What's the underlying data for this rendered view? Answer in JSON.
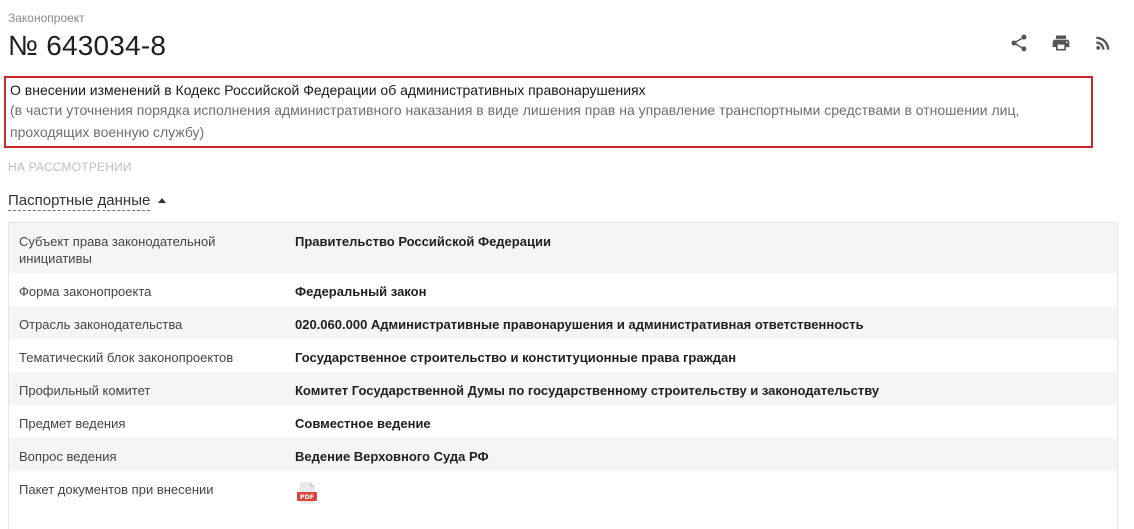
{
  "header": {
    "kicker": "Законопроект",
    "number": "№ 643034-8"
  },
  "actions": {
    "share_icon": "share-icon",
    "print_icon": "print-icon",
    "rss_icon": "rss-icon"
  },
  "title": {
    "main": "О внесении изменений в Кодекс Российской Федерации об административных правонарушениях",
    "sub": "(в части уточнения порядка исполнения административного наказания в виде лишения прав на управление транспортными средствами в отношении лиц, проходящих военную службу)"
  },
  "status": "НА РАССМОТРЕНИИ",
  "passport": {
    "toggle_label": "Паспортные данные",
    "rows": [
      {
        "label": "Субъект права законодательной инициативы",
        "value": "Правительство Российской Федерации"
      },
      {
        "label": "Форма законопроекта",
        "value": "Федеральный закон"
      },
      {
        "label": "Отрасль законодательства",
        "value": "020.060.000 Административные правонарушения и административная ответственность"
      },
      {
        "label": "Тематический блок законопроектов",
        "value": "Государственное строительство и конституционные права граждан"
      },
      {
        "label": "Профильный комитет",
        "value": "Комитет Государственной Думы по государственному строительству и законодательству"
      },
      {
        "label": "Предмет ведения",
        "value": "Совместное ведение"
      },
      {
        "label": "Вопрос ведения",
        "value": "Ведение Верховного Суда РФ"
      },
      {
        "label": "Пакет документов при внесении",
        "value": ""
      }
    ],
    "pdf_label": "PDF"
  },
  "colors": {
    "highlight_border": "#c9282d",
    "pdf_red": "#d9463f"
  }
}
